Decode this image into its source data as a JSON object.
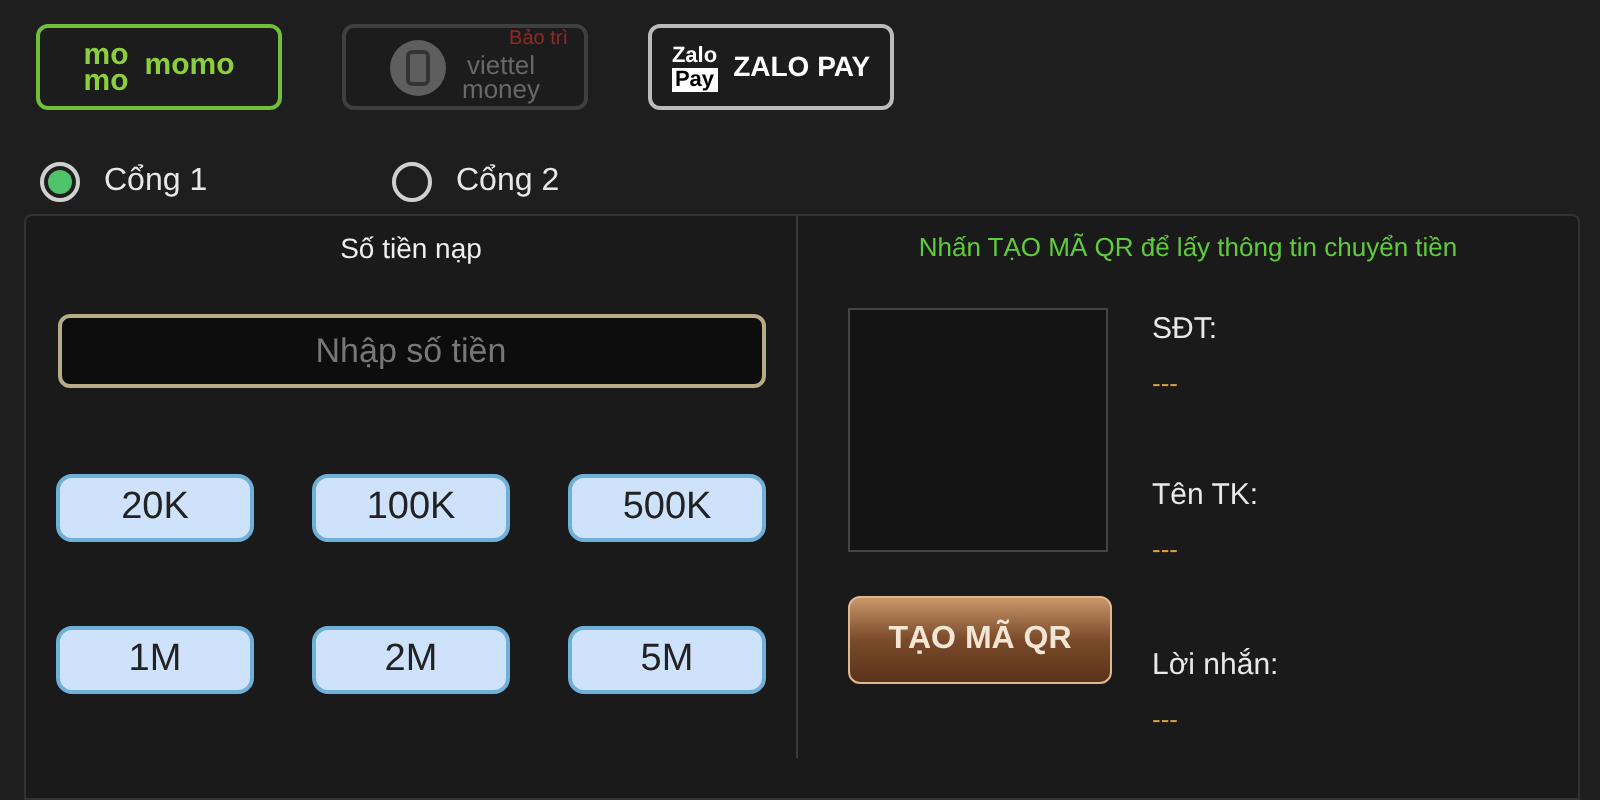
{
  "providers": [
    {
      "kind": "momo",
      "logo_lines": [
        "mo",
        "mo"
      ],
      "name": "momo",
      "selected": true,
      "disabled": false
    },
    {
      "kind": "viettel",
      "name_lines": [
        "viettel",
        "money"
      ],
      "badge": "Bảo trì",
      "selected": false,
      "disabled": true
    },
    {
      "kind": "zalopay",
      "logo_lines": [
        "Zalo",
        "Pay"
      ],
      "name": "ZALO PAY",
      "selected": false,
      "disabled": false
    }
  ],
  "gates": [
    {
      "label": "Cổng 1",
      "selected": true
    },
    {
      "label": "Cổng 2",
      "selected": false
    }
  ],
  "amount": {
    "title": "Số tiền nạp",
    "placeholder": "Nhập số tiền",
    "presets": [
      "20K",
      "100K",
      "500K",
      "1M",
      "2M",
      "5M"
    ]
  },
  "qr": {
    "hint": "Nhấn TẠO MÃ QR để lấy thông tin chuyển tiền",
    "button": "TẠO MÃ QR",
    "fields": [
      {
        "label": "SĐT:",
        "value": "---"
      },
      {
        "label": "Tên TK:",
        "value": "---"
      },
      {
        "label": "Lời nhắn:",
        "value": "---"
      }
    ]
  }
}
